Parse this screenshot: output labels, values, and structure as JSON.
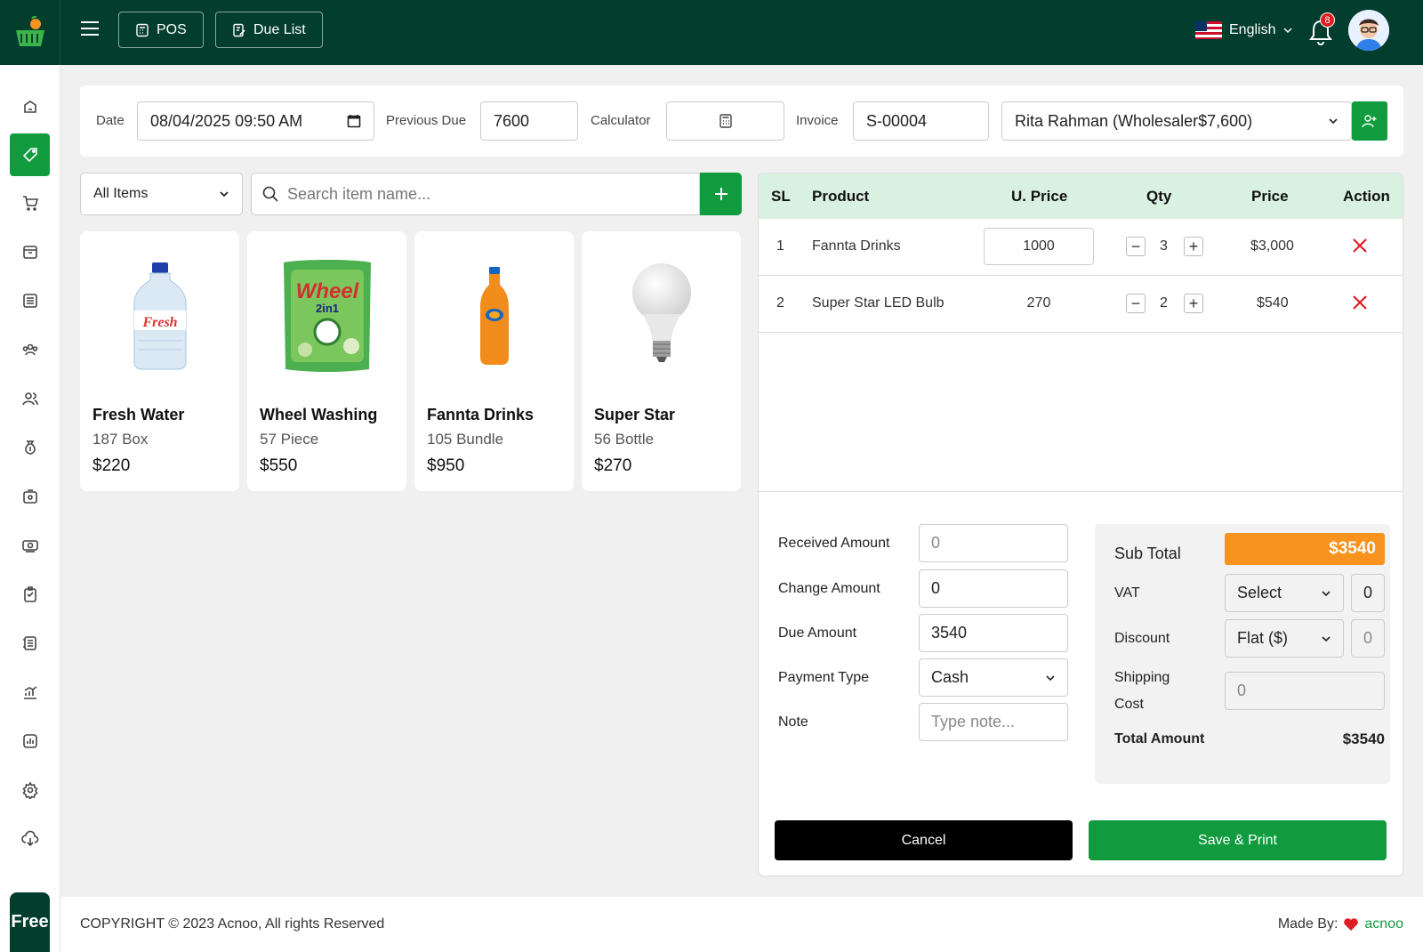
{
  "topbar": {
    "pos_label": "POS",
    "due_list_label": "Due List",
    "language": "English",
    "notification_count": "8"
  },
  "header": {
    "date_label": "Date",
    "date_value": "08/04/2025 09:50  AM",
    "previous_due_label": "Previous Due",
    "previous_due_value": "7600",
    "calculator_label": "Calculator",
    "invoice_label": "Invoice",
    "invoice_value": "S-00004",
    "customer_value": "Rita Rahman (Wholesaler$7,600)"
  },
  "filter": {
    "category": "All Items",
    "search_placeholder": "Search item name..."
  },
  "products": [
    {
      "name": "Fresh Water",
      "stock": "187 Box",
      "price": "$220"
    },
    {
      "name": "Wheel Washing",
      "stock": "57 Piece",
      "price": "$550"
    },
    {
      "name": "Fannta Drinks",
      "stock": "105 Bundle",
      "price": "$950"
    },
    {
      "name": "Super Star",
      "stock": "56 Bottle",
      "price": "$270"
    }
  ],
  "cart": {
    "headers": {
      "sl": "SL",
      "product": "Product",
      "unit_price": "U. Price",
      "qty": "Qty",
      "price": "Price",
      "action": "Action"
    },
    "rows": [
      {
        "sl": "1",
        "product": "Fannta Drinks",
        "unit_price": "1000",
        "qty": "3",
        "price": "$3,000"
      },
      {
        "sl": "2",
        "product": "Super Star LED Bulb",
        "unit_price": "270",
        "qty": "2",
        "price": "$540"
      }
    ]
  },
  "payment": {
    "received_label": "Received Amount",
    "received_placeholder": "0",
    "change_label": "Change Amount",
    "change_value": "0",
    "due_label": "Due Amount",
    "due_value": "3540",
    "payment_type_label": "Payment Type",
    "payment_type_value": "Cash",
    "note_label": "Note",
    "note_placeholder": "Type note..."
  },
  "summary": {
    "subtotal_label": "Sub Total",
    "subtotal_value": "$3540",
    "vat_label": "VAT",
    "vat_select": "Select",
    "vat_value": "0",
    "discount_label": "Discount",
    "discount_select": "Flat ($)",
    "discount_value": "0",
    "shipping_label_1": "Shipping",
    "shipping_label_2": "Cost",
    "shipping_placeholder": "0",
    "total_label": "Total Amount",
    "total_value": "$3540"
  },
  "actions": {
    "cancel": "Cancel",
    "save_print": "Save & Print"
  },
  "sidebar": {
    "free_badge": "Free"
  },
  "footer": {
    "copyright": "COPYRIGHT © 2023 Acnoo, All rights Reserved",
    "made_by": "Made By:",
    "brand": "acnoo"
  },
  "colors": {
    "brand_dark": "#023d2d",
    "accent_green": "#0f9b3e",
    "subtotal_orange": "#f7931e",
    "delete_red": "#e01b24"
  }
}
